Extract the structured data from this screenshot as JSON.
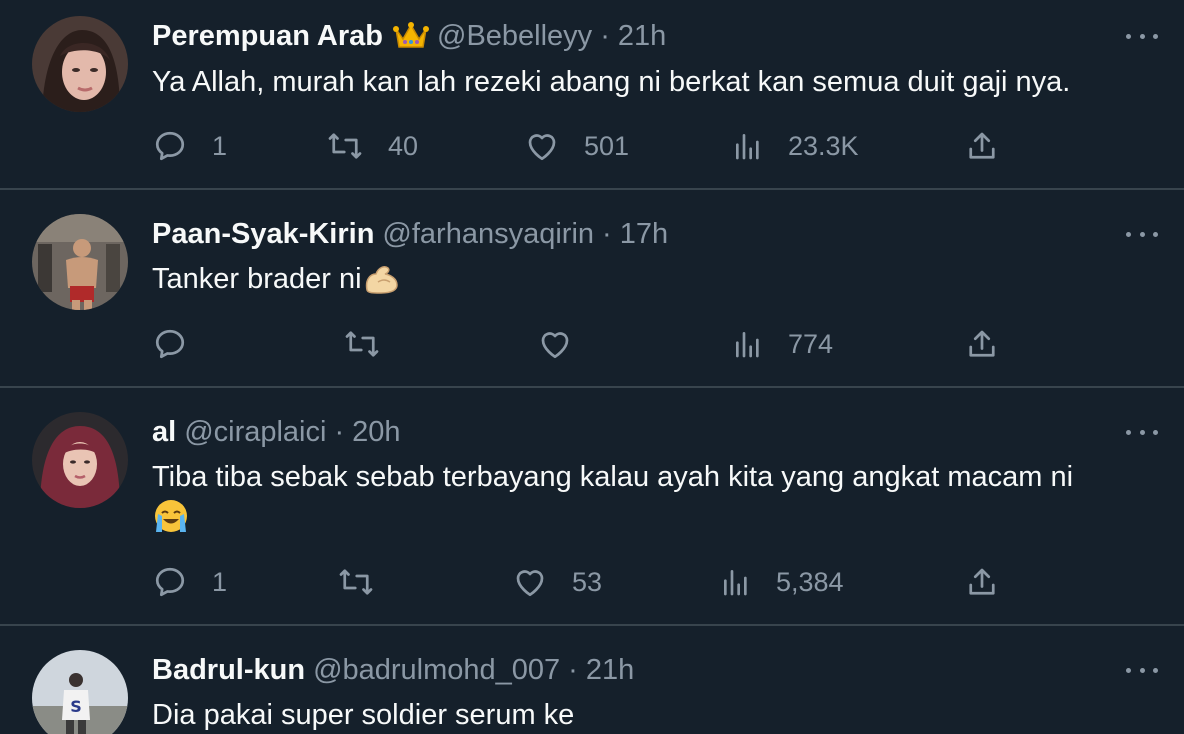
{
  "colors": {
    "background": "#15202b",
    "text": "#f7f9f9",
    "muted": "#8b98a5",
    "divider": "#38444d"
  },
  "tweets": [
    {
      "name": "Perempuan Arab",
      "badge_icon": "crown-emoji",
      "handle": "@Bebelleyy",
      "separator": "·",
      "time": "21h",
      "text": "Ya Allah, murah kan lah rezeki abang ni berkat kan semua duit gaji nya.",
      "reply_count": "1",
      "retweet_count": "40",
      "like_count": "501",
      "view_count": "23.3K"
    },
    {
      "name": "Paan-Syak-Kirin",
      "handle": "@farhansyaqirin",
      "separator": "·",
      "time": "17h",
      "text": "Tanker brader ni",
      "text_emoji_icon": "flexed-biceps-emoji",
      "reply_count": "",
      "retweet_count": "",
      "like_count": "",
      "view_count": "774"
    },
    {
      "name": "al",
      "handle": "@ciraplaici",
      "separator": "·",
      "time": "20h",
      "text": "Tiba tiba sebak sebab terbayang kalau ayah kita yang angkat macam ni",
      "text_emoji_icon": "loudly-crying-face-emoji",
      "reply_count": "1",
      "retweet_count": "",
      "like_count": "53",
      "view_count": "5,384"
    },
    {
      "name": "Badrul-kun",
      "handle": "@badrulmohd_007",
      "separator": "·",
      "time": "21h",
      "text": "Dia pakai super soldier serum ke"
    }
  ]
}
